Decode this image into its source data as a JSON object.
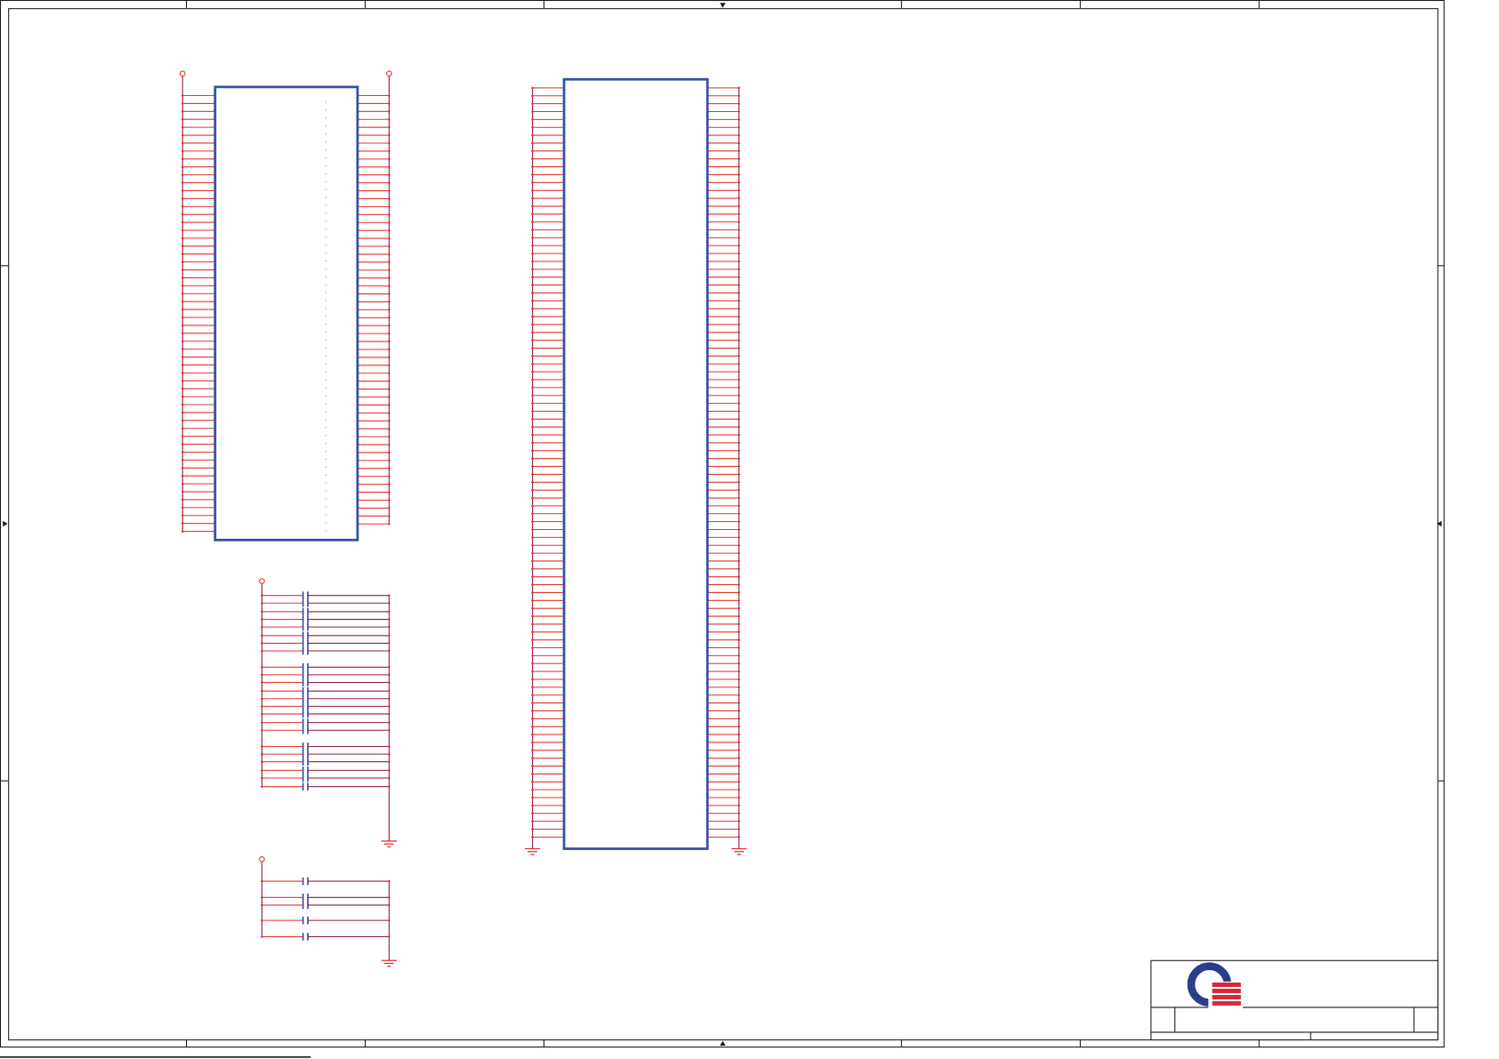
{
  "colors": {
    "pin_wire": "#e2332b",
    "net_wire": "#8e1b3f",
    "component_outline": "#3551a6",
    "capacitor_plate": "#3551a6",
    "frame": "#1a1a1a",
    "pin_dot": "#9a9a9a",
    "logo_blue": "#2b3e8c",
    "logo_red": "#d8283a"
  },
  "icons": {
    "logo": "company-logo-icon",
    "ground": "ground-icon",
    "power": "power-port-icon",
    "capacitor": "capacitor-icon"
  }
}
